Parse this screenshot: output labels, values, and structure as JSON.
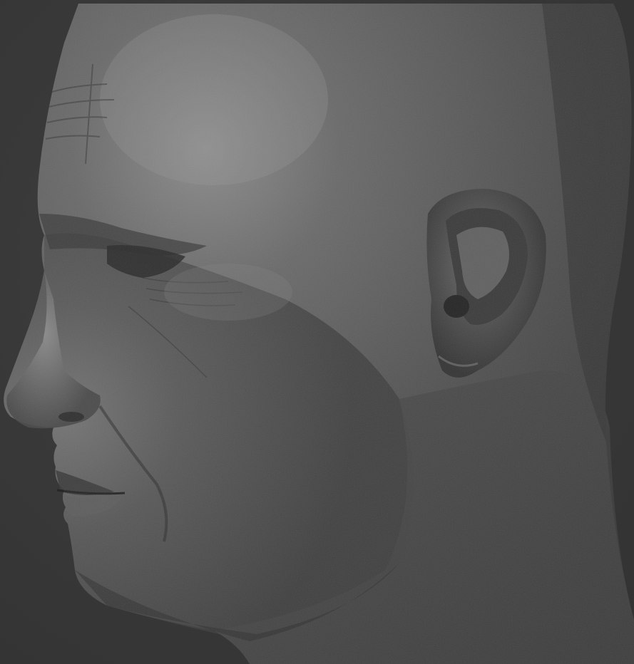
{
  "scene": {
    "subject": "",
    "background_color": "#3a3a3a",
    "material_colors": {
      "base": "#505050",
      "highlight": "#8a8a8a",
      "shadow": "#2a2a2a"
    }
  }
}
